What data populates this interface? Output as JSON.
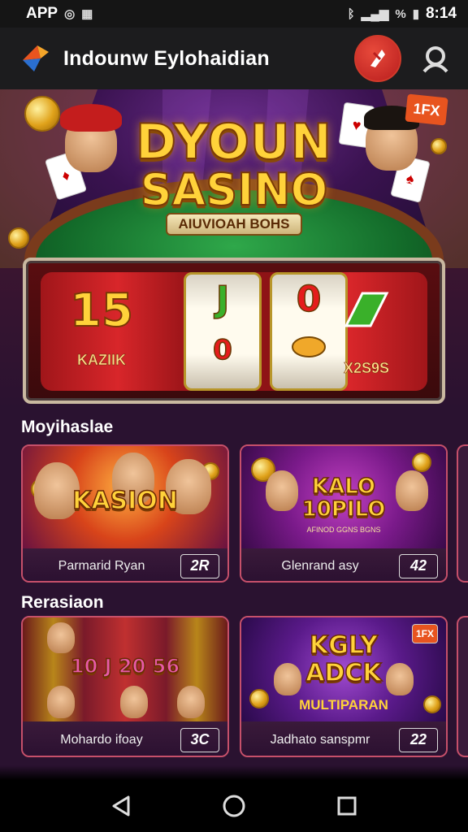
{
  "status_bar": {
    "left_text": "APP",
    "time": "8:14",
    "signal_text": "%"
  },
  "app_bar": {
    "title": "Indounw Eylohaidian",
    "badge_icon": "flame-badge-icon",
    "profile_icon": "user-profile-icon"
  },
  "hero": {
    "title_line1": "DYOUN",
    "title_line2": "SASINO",
    "subtitle": "AIUVIOAH BOHS",
    "tag": "1FX"
  },
  "slot": {
    "left_number": "15",
    "left_label": "KAZIIK",
    "reel1_top": "J",
    "reel1_bottom": "0",
    "reel2_top": "0",
    "right_label": "X2S9S"
  },
  "sections": [
    {
      "title": "Moyihaslae",
      "games": [
        {
          "art_title": "KASION",
          "art_sub": "",
          "name": "Parmarid Ryan",
          "count": "2R"
        },
        {
          "art_title": "KALO\n10PILO",
          "art_sub": "AFINOD GGNS BGNS",
          "name": "Glenrand asy",
          "count": "42"
        }
      ]
    },
    {
      "title": "Rerasiaon",
      "games": [
        {
          "art_title": "10 J 20 56",
          "art_sub": "",
          "name": "Mohardo ifoay",
          "count": "3C"
        },
        {
          "art_title": "KGLY\nADCK",
          "art_sub": "MULTIPARAN",
          "name": "Jadhato sanspmr",
          "count": "22"
        }
      ]
    }
  ],
  "nav": {
    "back_icon": "back-triangle-icon",
    "home_icon": "home-circle-icon",
    "recents_icon": "recents-square-icon"
  },
  "colors": {
    "background": "#2a1230",
    "card_border": "#c6506a",
    "accent_gold": "#ffd23a",
    "badge_red": "#d13a2a"
  }
}
